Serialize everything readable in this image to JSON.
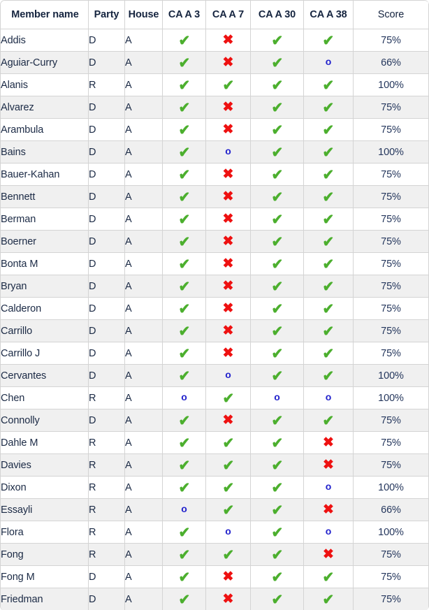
{
  "table": {
    "columns": [
      {
        "key": "name",
        "label": "Member name",
        "align": "center"
      },
      {
        "key": "party",
        "label": "Party",
        "align": "center"
      },
      {
        "key": "house",
        "label": "House",
        "align": "center"
      },
      {
        "key": "v1",
        "label": "CA A 3",
        "align": "center"
      },
      {
        "key": "v2",
        "label": "CA A 7",
        "align": "center"
      },
      {
        "key": "v3",
        "label": "CA A 30",
        "align": "center"
      },
      {
        "key": "v4",
        "label": "CA A 38",
        "align": "center"
      },
      {
        "key": "score",
        "label": "Score",
        "align": "center"
      }
    ],
    "marks": {
      "yes": {
        "glyph": "✔",
        "icon": "check-icon",
        "color": "#4caf2e"
      },
      "no": {
        "glyph": "✖",
        "icon": "cross-icon",
        "color": "#ee1111"
      },
      "abstain": {
        "glyph": "o",
        "icon": "circle-icon",
        "color": "#2222cc"
      }
    },
    "colors": {
      "header_text": "#15243f",
      "body_text": "#1b2a45",
      "score_text": "#24365c",
      "border": "#d4d4d4",
      "row_shade": "#f0f0f0",
      "row_plain": "#ffffff"
    },
    "rows": [
      {
        "name": "Addis",
        "party": "D",
        "house": "A",
        "votes": [
          "yes",
          "no",
          "yes",
          "yes"
        ],
        "score": "75%"
      },
      {
        "name": "Aguiar-Curry",
        "party": "D",
        "house": "A",
        "votes": [
          "yes",
          "no",
          "yes",
          "abstain"
        ],
        "score": "66%"
      },
      {
        "name": "Alanis",
        "party": "R",
        "house": "A",
        "votes": [
          "yes",
          "yes",
          "yes",
          "yes"
        ],
        "score": "100%"
      },
      {
        "name": "Alvarez",
        "party": "D",
        "house": "A",
        "votes": [
          "yes",
          "no",
          "yes",
          "yes"
        ],
        "score": "75%"
      },
      {
        "name": "Arambula",
        "party": "D",
        "house": "A",
        "votes": [
          "yes",
          "no",
          "yes",
          "yes"
        ],
        "score": "75%"
      },
      {
        "name": "Bains",
        "party": "D",
        "house": "A",
        "votes": [
          "yes",
          "abstain",
          "yes",
          "yes"
        ],
        "score": "100%"
      },
      {
        "name": "Bauer-Kahan",
        "party": "D",
        "house": "A",
        "votes": [
          "yes",
          "no",
          "yes",
          "yes"
        ],
        "score": "75%"
      },
      {
        "name": "Bennett",
        "party": "D",
        "house": "A",
        "votes": [
          "yes",
          "no",
          "yes",
          "yes"
        ],
        "score": "75%"
      },
      {
        "name": "Berman",
        "party": "D",
        "house": "A",
        "votes": [
          "yes",
          "no",
          "yes",
          "yes"
        ],
        "score": "75%"
      },
      {
        "name": "Boerner",
        "party": "D",
        "house": "A",
        "votes": [
          "yes",
          "no",
          "yes",
          "yes"
        ],
        "score": "75%"
      },
      {
        "name": "Bonta M",
        "party": "D",
        "house": "A",
        "votes": [
          "yes",
          "no",
          "yes",
          "yes"
        ],
        "score": "75%"
      },
      {
        "name": "Bryan",
        "party": "D",
        "house": "A",
        "votes": [
          "yes",
          "no",
          "yes",
          "yes"
        ],
        "score": "75%"
      },
      {
        "name": "Calderon",
        "party": "D",
        "house": "A",
        "votes": [
          "yes",
          "no",
          "yes",
          "yes"
        ],
        "score": "75%"
      },
      {
        "name": "Carrillo",
        "party": "D",
        "house": "A",
        "votes": [
          "yes",
          "no",
          "yes",
          "yes"
        ],
        "score": "75%"
      },
      {
        "name": "Carrillo J",
        "party": "D",
        "house": "A",
        "votes": [
          "yes",
          "no",
          "yes",
          "yes"
        ],
        "score": "75%"
      },
      {
        "name": "Cervantes",
        "party": "D",
        "house": "A",
        "votes": [
          "yes",
          "abstain",
          "yes",
          "yes"
        ],
        "score": "100%"
      },
      {
        "name": "Chen",
        "party": "R",
        "house": "A",
        "votes": [
          "abstain",
          "yes",
          "abstain",
          "abstain"
        ],
        "score": "100%"
      },
      {
        "name": "Connolly",
        "party": "D",
        "house": "A",
        "votes": [
          "yes",
          "no",
          "yes",
          "yes"
        ],
        "score": "75%"
      },
      {
        "name": "Dahle M",
        "party": "R",
        "house": "A",
        "votes": [
          "yes",
          "yes",
          "yes",
          "no"
        ],
        "score": "75%"
      },
      {
        "name": "Davies",
        "party": "R",
        "house": "A",
        "votes": [
          "yes",
          "yes",
          "yes",
          "no"
        ],
        "score": "75%"
      },
      {
        "name": "Dixon",
        "party": "R",
        "house": "A",
        "votes": [
          "yes",
          "yes",
          "yes",
          "abstain"
        ],
        "score": "100%"
      },
      {
        "name": "Essayli",
        "party": "R",
        "house": "A",
        "votes": [
          "abstain",
          "yes",
          "yes",
          "no"
        ],
        "score": "66%"
      },
      {
        "name": "Flora",
        "party": "R",
        "house": "A",
        "votes": [
          "yes",
          "abstain",
          "yes",
          "abstain"
        ],
        "score": "100%"
      },
      {
        "name": "Fong",
        "party": "R",
        "house": "A",
        "votes": [
          "yes",
          "yes",
          "yes",
          "no"
        ],
        "score": "75%"
      },
      {
        "name": "Fong M",
        "party": "D",
        "house": "A",
        "votes": [
          "yes",
          "no",
          "yes",
          "yes"
        ],
        "score": "75%"
      },
      {
        "name": "Friedman",
        "party": "D",
        "house": "A",
        "votes": [
          "yes",
          "no",
          "yes",
          "yes"
        ],
        "score": "75%"
      }
    ]
  }
}
